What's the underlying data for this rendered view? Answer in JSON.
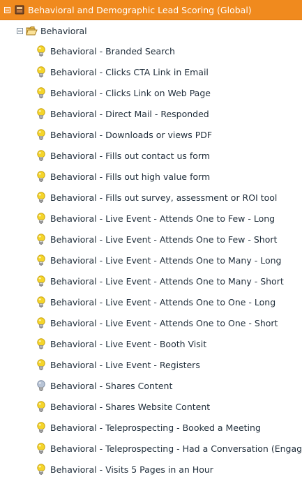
{
  "tree": {
    "root": {
      "label": "Behavioral and Demographic Lead Scoring (Global)",
      "icon": "program-icon",
      "expanded": true,
      "background": "#f08a1e"
    },
    "folder": {
      "label": "Behavioral",
      "icon": "folder-icon",
      "expanded": true
    },
    "campaigns": [
      {
        "label": "Behavioral - Branded Search",
        "status": "active"
      },
      {
        "label": "Behavioral - Clicks CTA Link in Email",
        "status": "active"
      },
      {
        "label": "Behavioral - Clicks Link on Web Page",
        "status": "active"
      },
      {
        "label": "Behavioral - Direct Mail - Responded",
        "status": "active"
      },
      {
        "label": "Behavioral - Downloads or views PDF",
        "status": "active"
      },
      {
        "label": "Behavioral - Fills out contact us form",
        "status": "active"
      },
      {
        "label": "Behavioral - Fills out high value form",
        "status": "active"
      },
      {
        "label": "Behavioral - Fills out survey, assessment or ROI tool",
        "status": "active"
      },
      {
        "label": "Behavioral - Live Event - Attends One to Few - Long",
        "status": "active"
      },
      {
        "label": "Behavioral - Live Event - Attends One to Few - Short",
        "status": "active"
      },
      {
        "label": "Behavioral - Live Event - Attends One to Many - Long",
        "status": "active"
      },
      {
        "label": "Behavioral - Live Event - Attends One to Many - Short",
        "status": "active"
      },
      {
        "label": "Behavioral - Live Event - Attends One to One - Long",
        "status": "active"
      },
      {
        "label": "Behavioral - Live Event - Attends One to One - Short",
        "status": "active"
      },
      {
        "label": "Behavioral - Live Event - Booth Visit",
        "status": "active"
      },
      {
        "label": "Behavioral - Live Event - Registers",
        "status": "active"
      },
      {
        "label": "Behavioral - Shares Content",
        "status": "inactive"
      },
      {
        "label": "Behavioral - Shares Website Content",
        "status": "active"
      },
      {
        "label": "Behavioral - Teleprospecting - Booked a Meeting",
        "status": "active"
      },
      {
        "label": "Behavioral - Teleprospecting - Had a Conversation (Engaged)",
        "status": "active"
      },
      {
        "label": "Behavioral - Visits 5 Pages in an Hour",
        "status": "active"
      }
    ],
    "colors": {
      "active_bulb": "#f5d52a",
      "inactive_bulb": "#b8c4d6",
      "text": "#1f2d3a"
    }
  }
}
